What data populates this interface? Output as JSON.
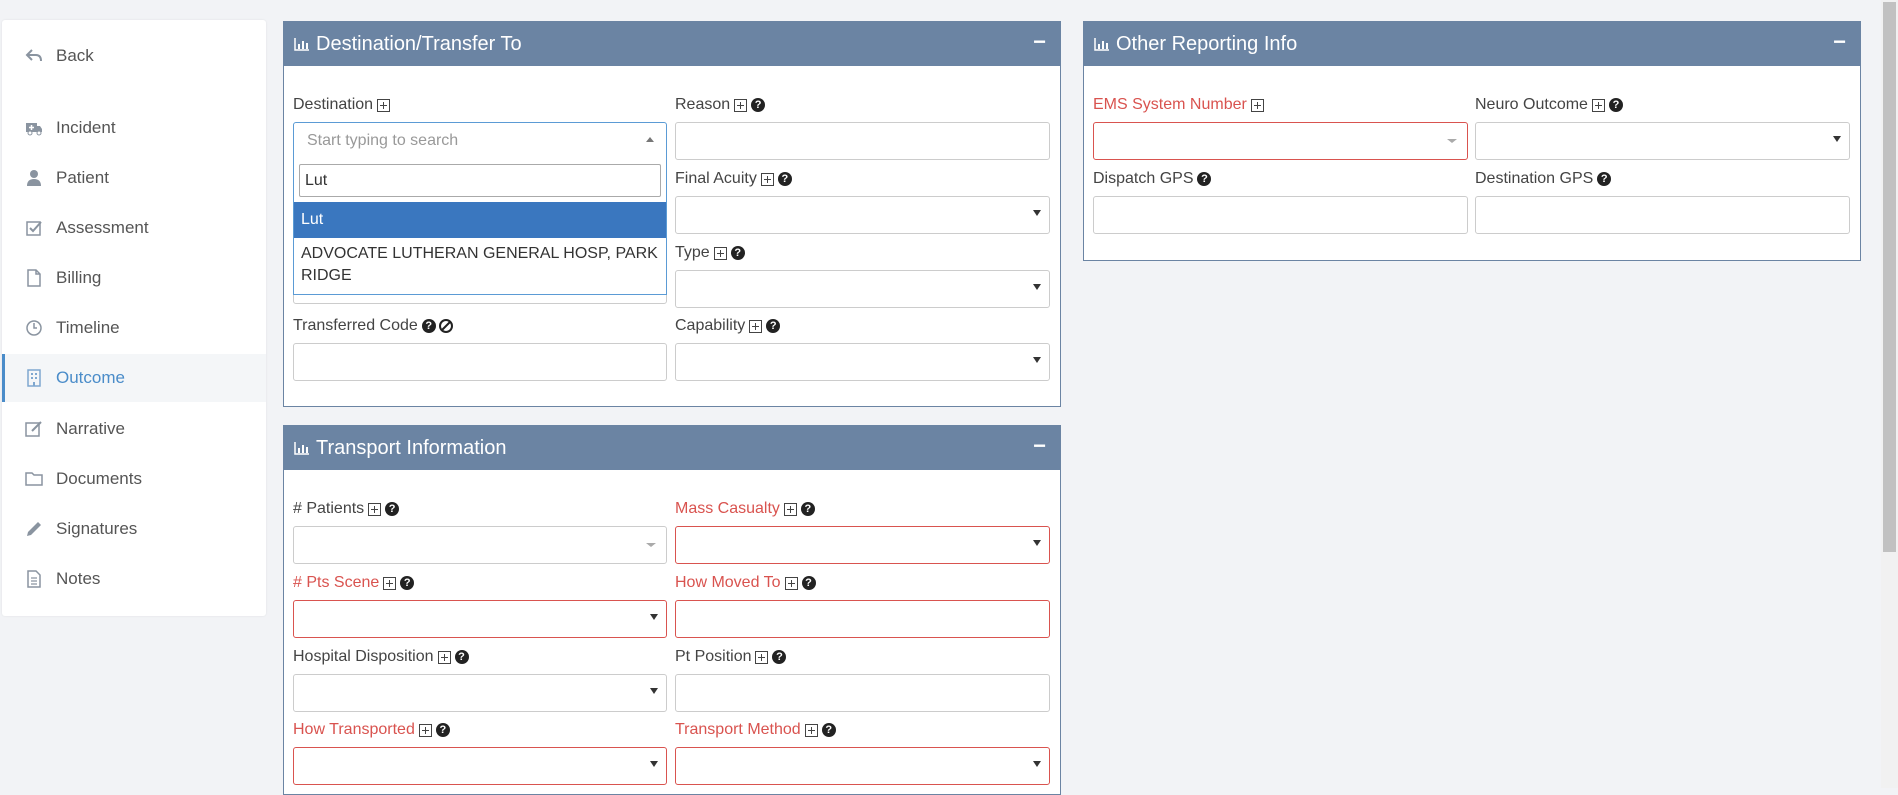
{
  "sidebar": {
    "items": [
      {
        "label": "Back",
        "icon": "back-arrow-icon"
      },
      {
        "label": "Incident",
        "icon": "ambulance-icon"
      },
      {
        "label": "Patient",
        "icon": "user-icon"
      },
      {
        "label": "Assessment",
        "icon": "checkbox-icon"
      },
      {
        "label": "Billing",
        "icon": "file-icon"
      },
      {
        "label": "Timeline",
        "icon": "clock-icon"
      },
      {
        "label": "Outcome",
        "icon": "building-icon",
        "active": true
      },
      {
        "label": "Narrative",
        "icon": "edit-icon"
      },
      {
        "label": "Documents",
        "icon": "folder-icon"
      },
      {
        "label": "Signatures",
        "icon": "pencil-icon"
      },
      {
        "label": "Notes",
        "icon": "note-icon"
      }
    ]
  },
  "destination_panel": {
    "title": "Destination/Transfer To",
    "collapse": "−",
    "destination_label": "Destination",
    "destination_placeholder": "Start typing to search",
    "search_value": "Lut",
    "options": [
      "Lut",
      "ADVOCATE LUTHERAN GENERAL HOSP, PARK RIDGE"
    ],
    "reason_label": "Reason",
    "final_acuity_label": "Final Acuity",
    "type_label": "Type",
    "transferred_code_label": "Transferred Code",
    "capability_label": "Capability"
  },
  "transport_panel": {
    "title": "Transport Information",
    "collapse": "−",
    "patients_label": "# Patients",
    "mass_casualty_label": "Mass Casualty",
    "pts_scene_label": "# Pts Scene",
    "how_moved_to_label": "How Moved To",
    "hospital_disposition_label": "Hospital Disposition",
    "pt_position_label": "Pt Position",
    "how_transported_label": "How Transported",
    "transport_method_label": "Transport Method"
  },
  "other_panel": {
    "title": "Other Reporting Info",
    "collapse": "−",
    "ems_system_number_label": "EMS System Number",
    "neuro_outcome_label": "Neuro Outcome",
    "dispatch_gps_label": "Dispatch GPS",
    "destination_gps_label": "Destination GPS"
  },
  "colors": {
    "panel_header": "#6b84a3",
    "required": "#d9534f",
    "active_nav": "#4a8cc9",
    "highlight": "#3a77bf"
  }
}
